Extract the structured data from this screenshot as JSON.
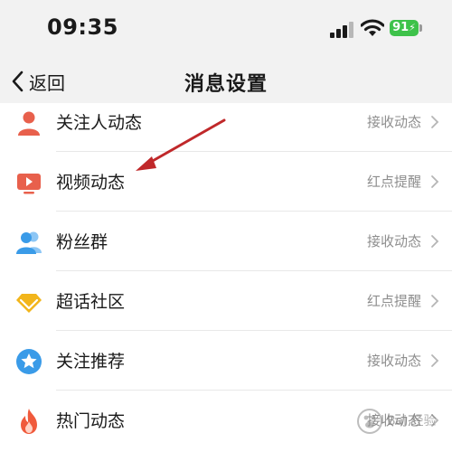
{
  "status_bar": {
    "time": "09:35",
    "battery": "91",
    "battery_color": "#3ec24a"
  },
  "nav": {
    "back_label": "返回",
    "title": "消息设置"
  },
  "rows": [
    {
      "label": "关注人动态",
      "value": "接收动态",
      "icon": "person-icon",
      "icon_color": "#e8604c"
    },
    {
      "label": "视频动态",
      "value": "红点提醒",
      "icon": "video-icon",
      "icon_color": "#e8604c"
    },
    {
      "label": "粉丝群",
      "value": "接收动态",
      "icon": "group-icon",
      "icon_color": "#3a9be8"
    },
    {
      "label": "超话社区",
      "value": "红点提醒",
      "icon": "diamond-icon",
      "icon_color": "#f2b51b"
    },
    {
      "label": "关注推荐",
      "value": "接收动态",
      "icon": "star-badge-icon",
      "icon_color": "#3a9be8"
    },
    {
      "label": "热门动态",
      "value": "接收动态",
      "icon": "flame-icon",
      "icon_color": "#f05a3c"
    }
  ],
  "annotation": {
    "arrow_color": "#c0282a"
  },
  "watermark": {
    "text": "Bai 经验"
  }
}
